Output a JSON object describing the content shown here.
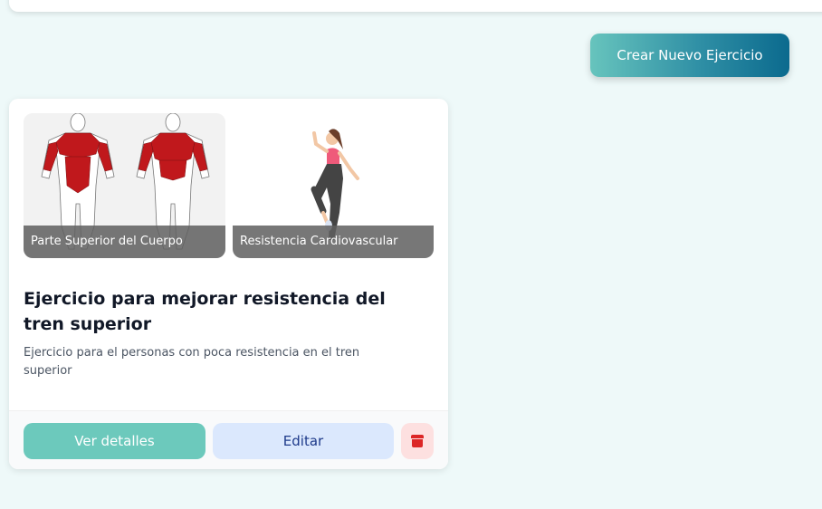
{
  "header": {
    "create_button_label": "Crear Nuevo Ejercicio"
  },
  "card": {
    "images": [
      {
        "label": "Parte Superior del Cuerpo",
        "icon": "muscle-anatomy-illustration"
      },
      {
        "label": "Resistencia Cardiovascular",
        "icon": "woman-exercising-illustration"
      }
    ],
    "title": "Ejercicio para mejorar resistencia del tren superior",
    "description": "Ejercicio para el personas con poca resistencia en el tren superior",
    "actions": {
      "view_label": "Ver detalles",
      "edit_label": "Editar",
      "delete_icon": "trash-icon"
    }
  },
  "colors": {
    "page_background": "#eef9f9",
    "primary_gradient_start": "#67c4bd",
    "primary_gradient_end": "#0b6a8e",
    "view_button": "#6cc9bc",
    "edit_button": "#dbe8fd",
    "delete_button": "#fde0e0",
    "delete_icon": "#dc2626"
  }
}
